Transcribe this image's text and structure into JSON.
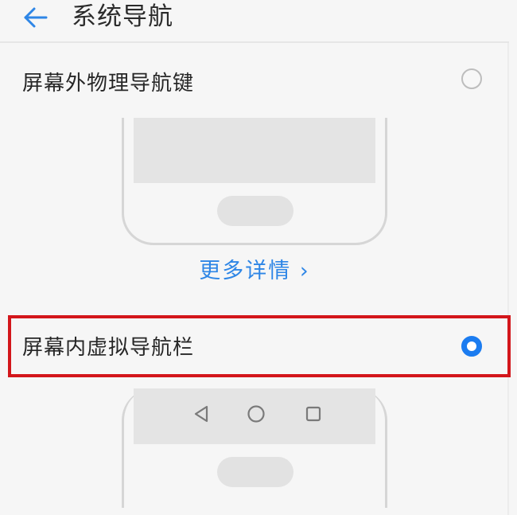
{
  "header": {
    "title": "系统导航",
    "back_icon": "arrow-left-icon"
  },
  "options": [
    {
      "label": "屏幕外物理导航键",
      "selected": false
    },
    {
      "label": "屏幕内虚拟导航栏",
      "selected": true
    }
  ],
  "more_details": {
    "label": "更多详情 ›"
  },
  "virtual_nav": {
    "keys": [
      "back-triangle-icon",
      "home-circle-icon",
      "recent-square-icon"
    ]
  },
  "colors": {
    "accent": "#1b7cf0",
    "link": "#2e86e6",
    "highlight_border": "#d3161b"
  }
}
